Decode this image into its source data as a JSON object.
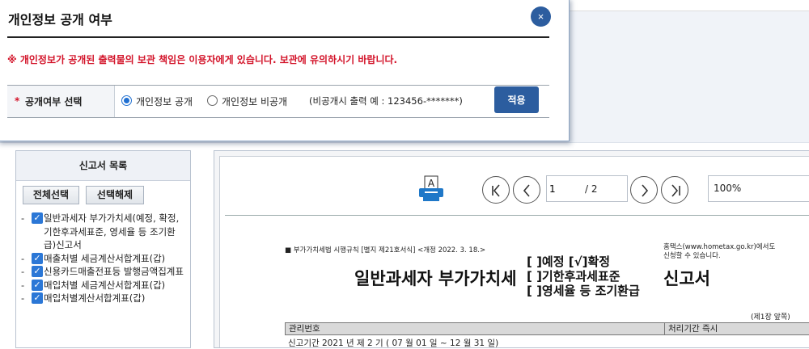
{
  "modal": {
    "title": "개인정보 공개 여부",
    "close_icon": "×",
    "warning": "※ 개인정보가 공개된 출력물의 보관 책임은 이용자에게 있습니다. 보관에 유의하시기 바랍니다.",
    "field_asterisk": "*",
    "field_label": "공개여부 선택",
    "option_public": "개인정보 공개",
    "option_private": "개인정보 비공개",
    "option_note": "(비공개시 출력 예 : 123456-*******)",
    "selected": "개인정보 공개",
    "apply_label": "적용",
    "accent_color": "#2c5d9f",
    "warning_color": "#d3142a"
  },
  "left_panel": {
    "title": "신고서 목록",
    "select_all_label": "전체선택",
    "deselect_all_label": "선택해제",
    "items": [
      {
        "label": "일반과세자 부가가치세(예정, 확정, 기한후과세표준, 영세율 등 조기환급)신고서",
        "checked": true
      },
      {
        "label": "매출처별 세금계산서합계표(갑)",
        "checked": true
      },
      {
        "label": "신용카드매출전표등 발행금액집계표",
        "checked": true
      },
      {
        "label": "매입처별 세금계산서합계표(갑)",
        "checked": true
      },
      {
        "label": "매입처별계산서합계표(갑)",
        "checked": true
      }
    ]
  },
  "viewer": {
    "page_current": "1",
    "page_total": "/ 2",
    "zoom": "100%",
    "printer_letter": "A",
    "icons": [
      "printer-icon",
      "first-page-icon",
      "prev-page-icon",
      "next-page-icon",
      "last-page-icon"
    ]
  },
  "document": {
    "law_ref": "■ 부가가치세법 시행규칙 [별지 제21호서식] <개정 2022. 3. 18.>",
    "hometax_line1": "홈택스(www.hometax.go.kr)에서도",
    "hometax_line2": "신청할 수 있습니다.",
    "title_main": "일반과세자 부가가치세",
    "option_1": "[ ]예정  [√]확정",
    "option_2": "[ ]기한후과세표준",
    "option_3": "[ ]영세율 등 조기환급",
    "title_tail": "신고서",
    "page_note": "(제1장 앞쪽)",
    "row_label": "관리번호",
    "row_period": "처리기간 즉시",
    "period_text": "신고기간 2021 년 제  2  기 (  07 월     01 일 ~ 12 월   31 일)"
  }
}
